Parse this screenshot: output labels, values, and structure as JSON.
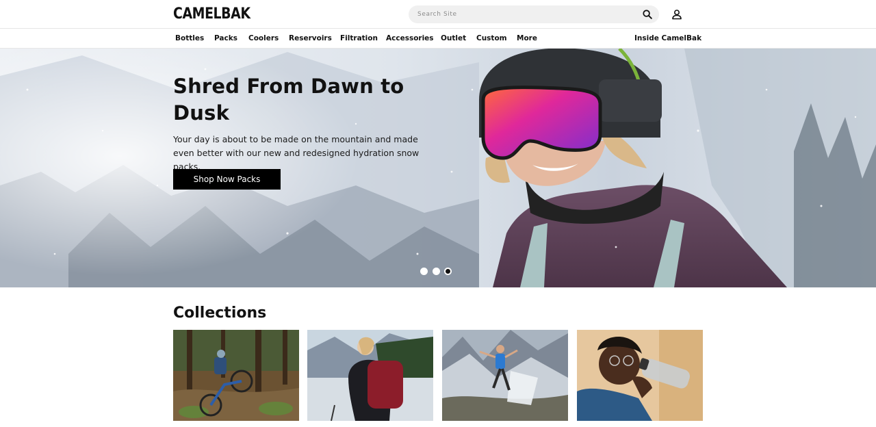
{
  "brand": {
    "logo_text": "CAMELBAK"
  },
  "search": {
    "placeholder": "Search Site"
  },
  "icons": {
    "search": "search-icon",
    "account": "user-icon"
  },
  "nav": {
    "items": [
      "Bottles",
      "Packs",
      "Coolers",
      "Reservoirs",
      "Filtration",
      "Accessories",
      "Outlet",
      "Custom",
      "More"
    ],
    "right_link": "Inside CamelBak"
  },
  "hero": {
    "title": "Shred From Dawn to Dusk",
    "text": "Your day is about to be made on the mountain and made even better with our new and redesigned hydration snow packs.",
    "cta": "Shop Now Packs",
    "slides_total": 3,
    "active_slide": 3
  },
  "collections": {
    "title": "Collections",
    "cards": [
      "mountain-biker-forest",
      "hiker-red-backpack",
      "trail-runner-mountains",
      "man-drinking-bottle"
    ]
  },
  "colors": {
    "button": "#000000",
    "text": "#111111"
  }
}
